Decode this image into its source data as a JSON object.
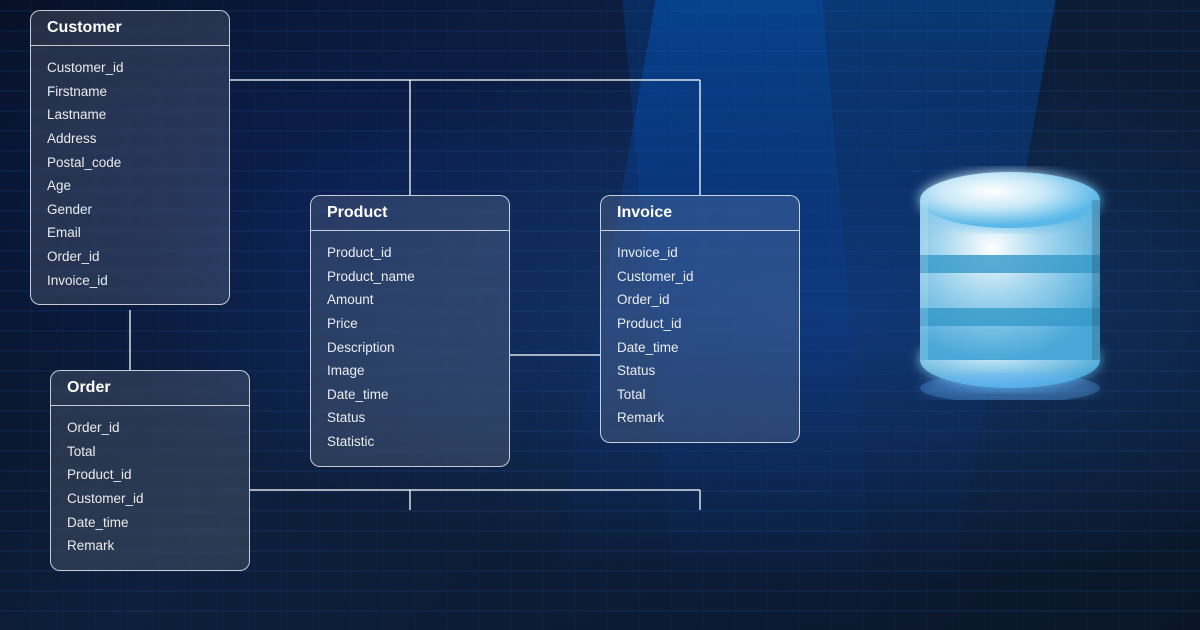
{
  "background": {
    "color": "#0a1628"
  },
  "entities": {
    "customer": {
      "title": "Customer",
      "fields": [
        "Customer_id",
        "Firstname",
        "Lastname",
        "Address",
        "Postal_code",
        "Age",
        "Gender",
        "Email",
        "Order_id",
        "Invoice_id"
      ]
    },
    "order": {
      "title": "Order",
      "fields": [
        "Order_id",
        "Total",
        "Product_id",
        "Customer_id",
        "Date_time",
        "Remark"
      ]
    },
    "product": {
      "title": "Product",
      "fields": [
        "Product_id",
        "Product_name",
        "Amount",
        "Price",
        "Description",
        "Image",
        "Date_time",
        "Status",
        "Statistic"
      ]
    },
    "invoice": {
      "title": "Invoice",
      "fields": [
        "Invoice_id",
        "Customer_id",
        "Order_id",
        "Product_id",
        "Date_time",
        "Status",
        "Total",
        "Remark"
      ]
    }
  }
}
